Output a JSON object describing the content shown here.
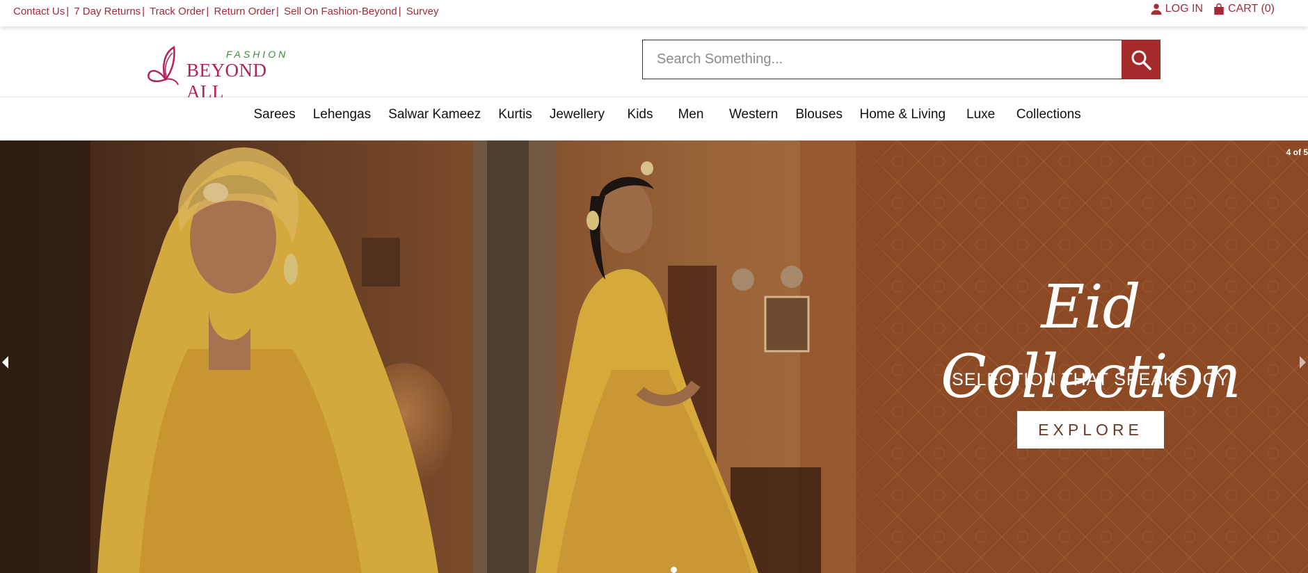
{
  "topbar": {
    "links": [
      "Contact Us",
      "7 Day Returns",
      "Track Order",
      "Return Order",
      "Sell On Fashion-Beyond",
      "Survey"
    ],
    "login_label": "LOG IN",
    "cart_label": "CART (0)"
  },
  "brand": {
    "line1": "FASHION",
    "line2": "BEYOND ALL",
    "colors": {
      "primary": "#b51f5a",
      "accent": "#3c8c3c"
    }
  },
  "search": {
    "placeholder": "Search Something...",
    "icon": "search-icon",
    "button_color": "#a52a2a"
  },
  "nav": {
    "items": [
      "Sarees",
      "Lehengas",
      "Salwar Kameez",
      "Kurtis",
      "Jewellery",
      "Kids",
      "Men",
      "Western",
      "Blouses",
      "Home & Living",
      "Luxe",
      "Collections"
    ]
  },
  "hero": {
    "slide_counter": "4 of 5",
    "title": "Eid Collection",
    "subtitle": "SELECTION THAT SPEAKS JOY",
    "cta": "EXPLORE",
    "current_slide": 4,
    "total_slides": 5
  },
  "theme": {
    "link_color": "#a52a3a"
  }
}
